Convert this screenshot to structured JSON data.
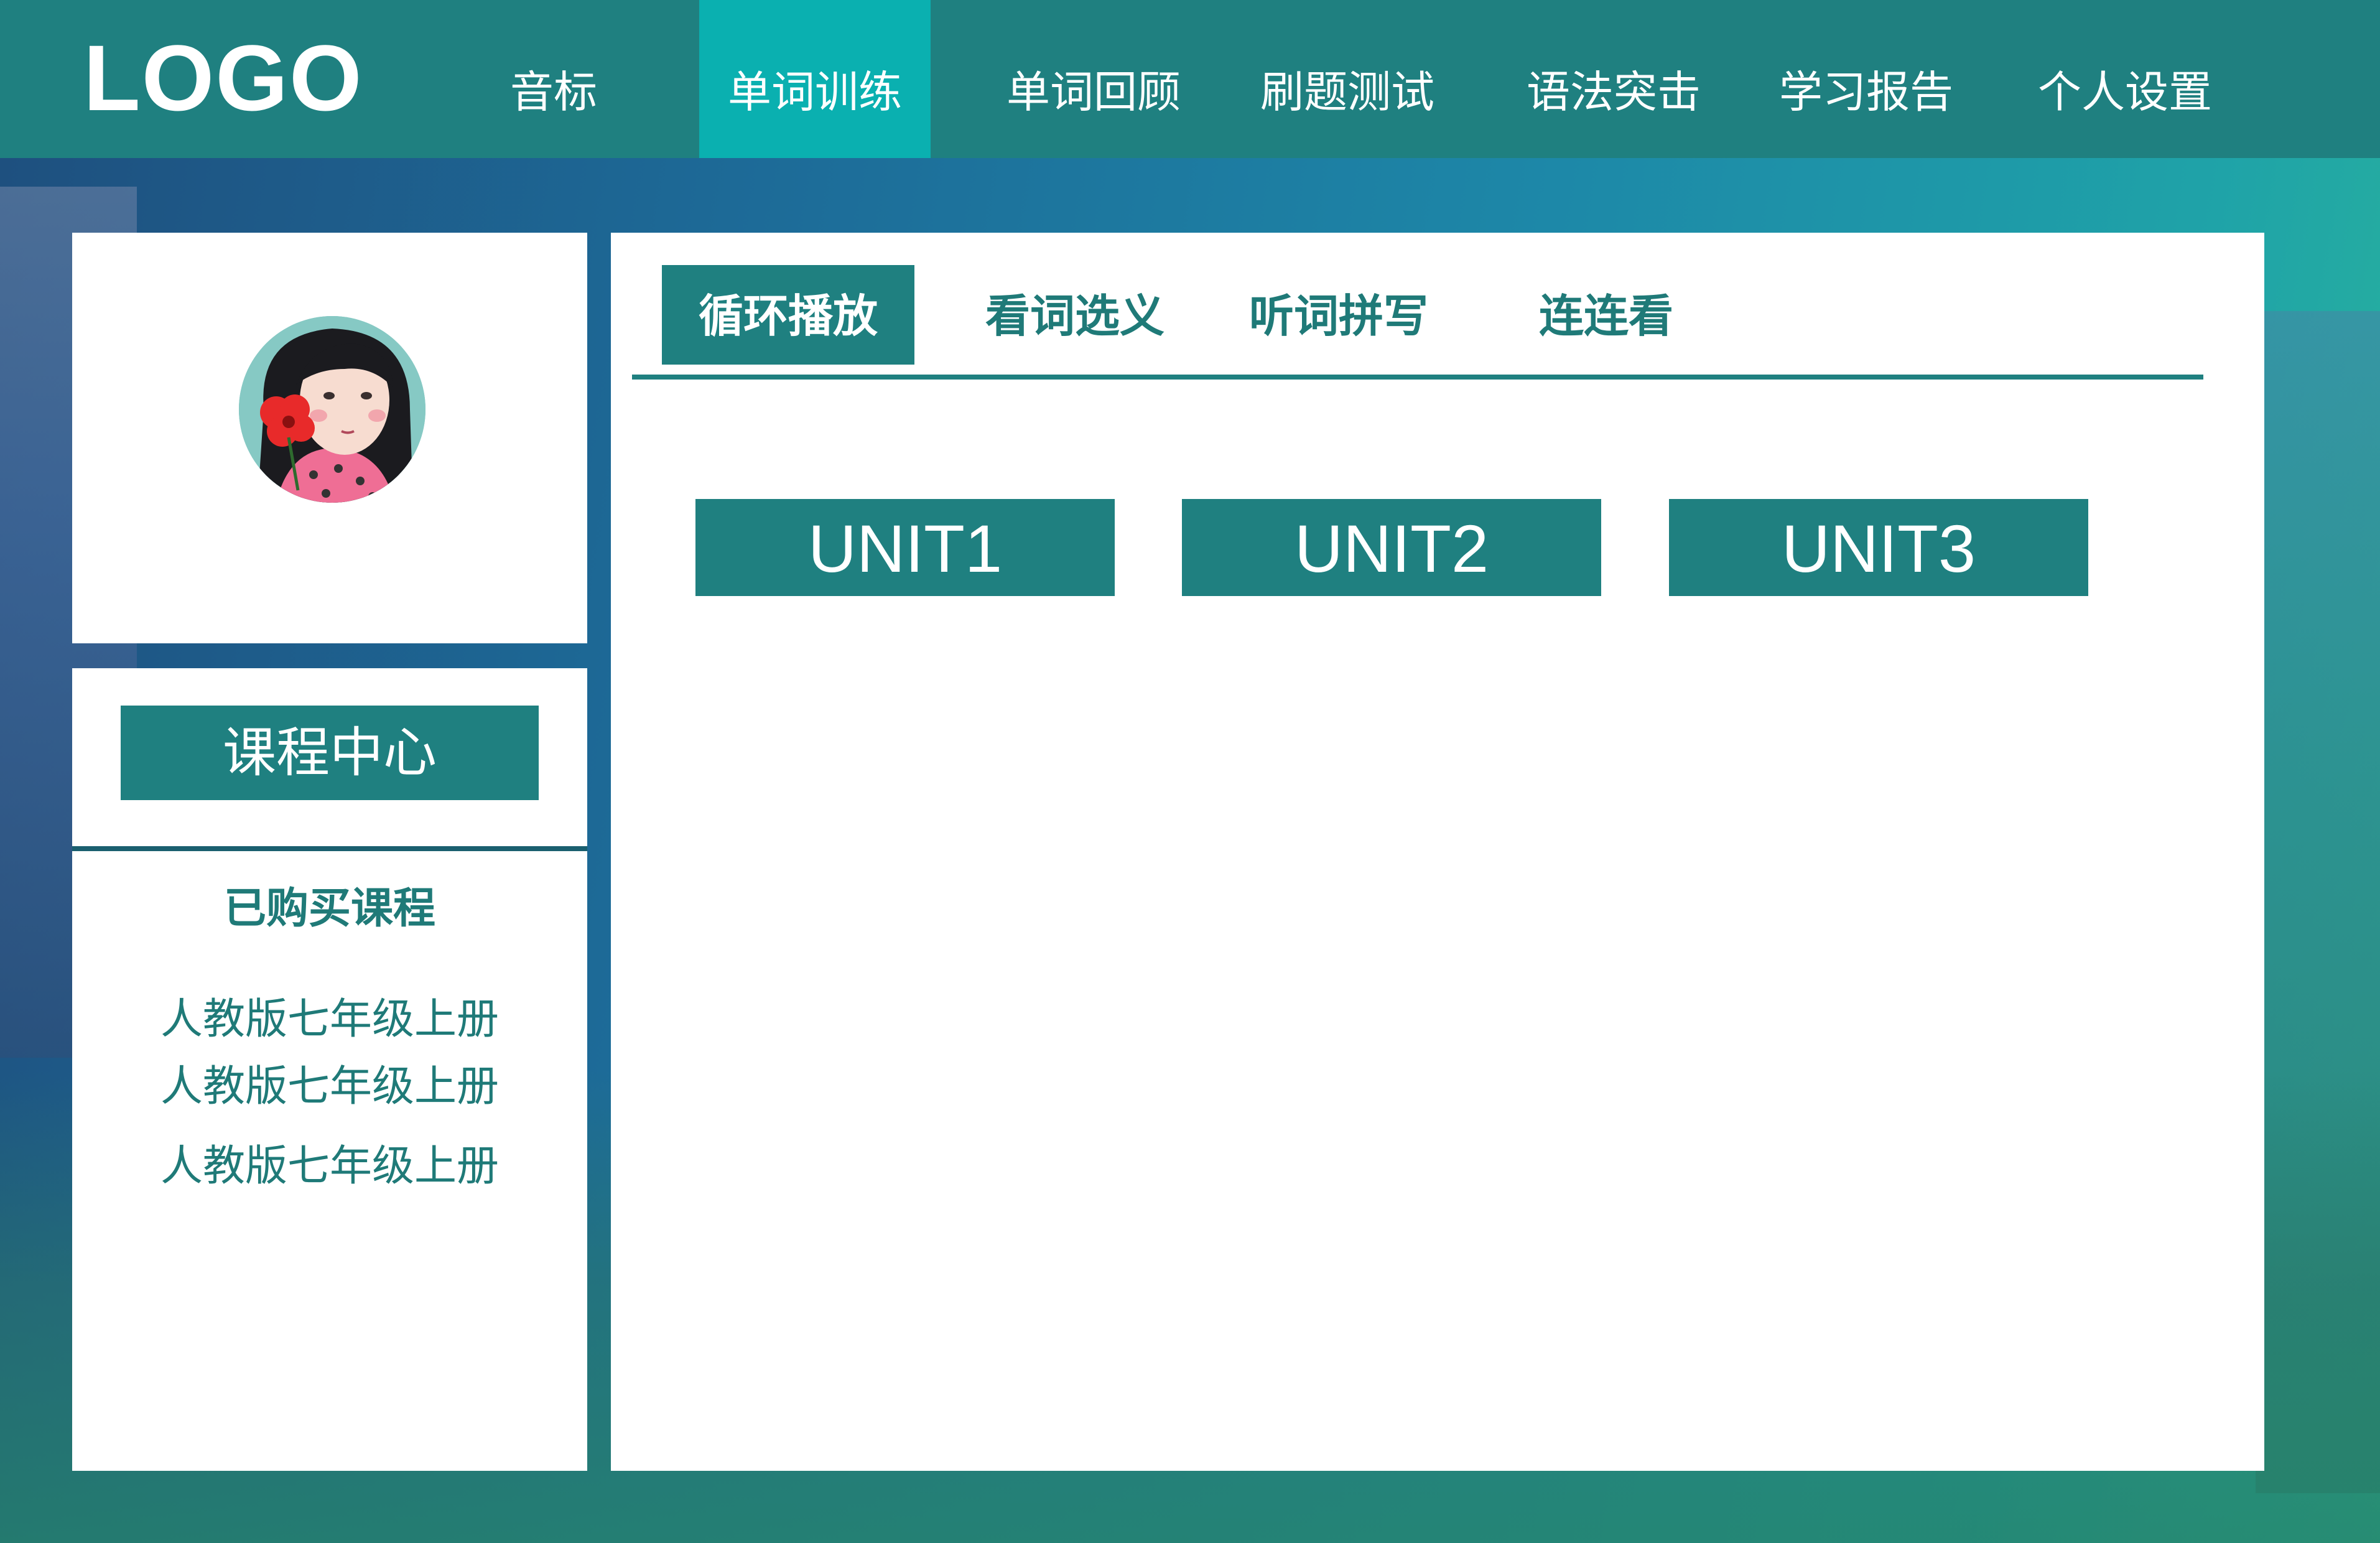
{
  "header": {
    "logo": "LOGO",
    "nav": [
      {
        "label": "音标"
      },
      {
        "label": "单词训练",
        "active": true
      },
      {
        "label": "单词回顾"
      },
      {
        "label": "刷题测试"
      },
      {
        "label": "语法突击"
      },
      {
        "label": "学习报告"
      },
      {
        "label": "个人设置"
      }
    ]
  },
  "sidebar": {
    "course_center": "课程中心",
    "purchased_title": "已购买课程",
    "courses": [
      "人教版七年级上册",
      "人教版七年级上册",
      "人教版七年级上册"
    ]
  },
  "main": {
    "tabs": [
      {
        "label": "循环播放",
        "active": true
      },
      {
        "label": "看词选义"
      },
      {
        "label": "听词拼写"
      },
      {
        "label": "连连看"
      }
    ],
    "units": [
      "UNIT1",
      "UNIT2",
      "UNIT3"
    ]
  },
  "colors": {
    "primary": "#1f8080",
    "active_nav": "#0ab0b0",
    "text_accent": "#1f7a78"
  }
}
